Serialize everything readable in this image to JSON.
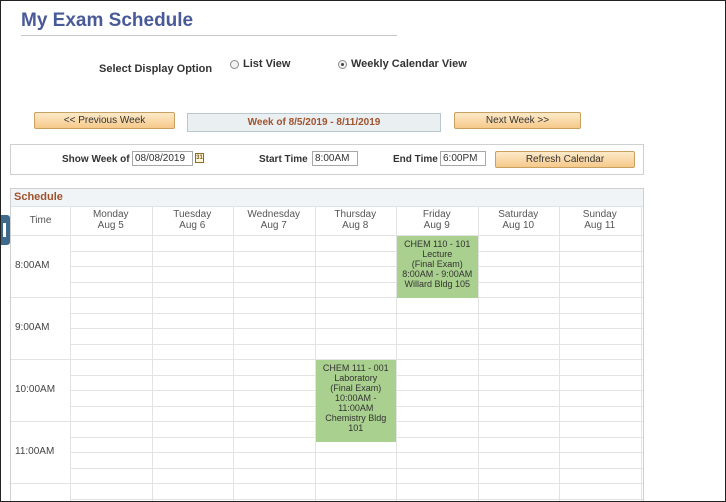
{
  "page": {
    "title": "My Exam Schedule"
  },
  "display_option": {
    "label": "Select Display Option",
    "options": [
      {
        "label": "List View",
        "selected": false
      },
      {
        "label": "Weekly Calendar View",
        "selected": true
      }
    ]
  },
  "week_nav": {
    "prev_label": "<< Previous Week",
    "current": "Week of 8/5/2019 - 8/11/2019",
    "next_label": "Next Week >>"
  },
  "filters": {
    "show_week_label": "Show Week of",
    "show_week_value": "08/08/2019",
    "calendar_icon": "calendar-icon",
    "start_time_label": "Start Time",
    "start_time_value": "8:00AM",
    "end_time_label": "End Time",
    "end_time_value": "6:00PM",
    "refresh_label": "Refresh Calendar"
  },
  "schedule": {
    "title": "Schedule",
    "time_header": "Time",
    "days": [
      {
        "name": "Monday",
        "date": "Aug 5"
      },
      {
        "name": "Tuesday",
        "date": "Aug 6"
      },
      {
        "name": "Wednesday",
        "date": "Aug 7"
      },
      {
        "name": "Thursday",
        "date": "Aug 8"
      },
      {
        "name": "Friday",
        "date": "Aug 9"
      },
      {
        "name": "Saturday",
        "date": "Aug 10"
      },
      {
        "name": "Sunday",
        "date": "Aug 11"
      }
    ],
    "times": [
      "8:00AM",
      "9:00AM",
      "10:00AM",
      "11:00AM"
    ],
    "events": [
      {
        "day": "Friday",
        "lines": [
          "CHEM 110 - 101",
          "Lecture",
          "(Final Exam)",
          "8:00AM - 9:00AM",
          "Willard Bldg 105"
        ]
      },
      {
        "day": "Thursday",
        "lines": [
          "CHEM 111 - 001",
          "Laboratory",
          "(Final Exam)",
          "10:00AM -",
          "11:00AM",
          "Chemistry Bldg",
          "101"
        ]
      }
    ],
    "event_color": "#a9d08e"
  }
}
